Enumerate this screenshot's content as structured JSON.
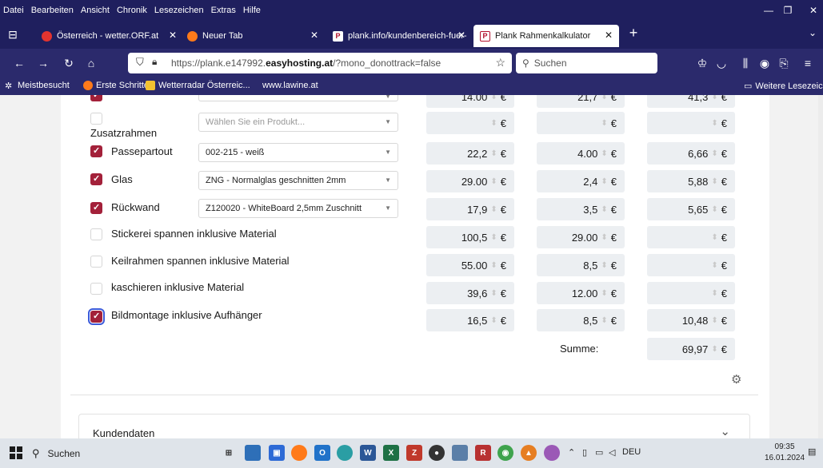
{
  "menubar": {
    "items": [
      "Datei",
      "Bearbeiten",
      "Ansicht",
      "Chronik",
      "Lesezeichen",
      "Extras",
      "Hilfe"
    ]
  },
  "tabs": [
    {
      "label": "Österreich - wetter.ORF.at"
    },
    {
      "label": "Neuer Tab"
    },
    {
      "label": "plank.info/kundenbereich-fuer-"
    },
    {
      "label": "Plank Rahmenkalkulator"
    }
  ],
  "navbar": {
    "url_prefix": "https://plank.e147992.",
    "url_domain": "easyhosting.at",
    "url_suffix": "/?mono_donottrack=false",
    "search_placeholder": "Suchen"
  },
  "bookmarks": {
    "items": [
      "Meistbesucht",
      "Erste Schritte",
      "Wetterradar Österreic...",
      "www.lawine.at"
    ],
    "more": "Weitere Lesezeichen"
  },
  "calculator": {
    "partial_prices": [
      "14.00",
      "21,7",
      "41,3"
    ],
    "rows": [
      {
        "label": "Zusatzrahmen",
        "checked": false,
        "select": "Wählen Sie ein Produkt...",
        "p1": "",
        "p2": "",
        "p3": ""
      },
      {
        "label": "Passepartout",
        "checked": true,
        "select": "002-215 - weiß",
        "p1": "22,2",
        "p2": "4.00",
        "p3": "6,66"
      },
      {
        "label": "Glas",
        "checked": true,
        "select": "ZNG - Normalglas geschnitten 2mm",
        "p1": "29.00",
        "p2": "2,4",
        "p3": "5,88"
      },
      {
        "label": "Rückwand",
        "checked": true,
        "select": "Z120020 - WhiteBoard 2,5mm Zuschnitt",
        "p1": "17,9",
        "p2": "3,5",
        "p3": "5,65"
      },
      {
        "label": "Stickerei spannen inklusive Material",
        "checked": false,
        "p1": "100,5",
        "p2": "29.00",
        "p3": ""
      },
      {
        "label": "Keilrahmen spannen inklusive Material",
        "checked": false,
        "p1": "55.00",
        "p2": "8,5",
        "p3": ""
      },
      {
        "label": "kaschieren inklusive Material",
        "checked": false,
        "p1": "39,6",
        "p2": "12.00",
        "p3": ""
      },
      {
        "label": "Bildmontage inklusive Aufhänger",
        "checked": true,
        "p1": "16,5",
        "p2": "8,5",
        "p3": "10,48"
      }
    ],
    "currency": "€",
    "summe_label": "Summe:",
    "summe_value": "69,97"
  },
  "customer_card": {
    "title": "Kundendaten"
  },
  "taskbar": {
    "search_label": "Suchen",
    "language": "DEU",
    "time": "09:35",
    "date": "16.01.2024"
  },
  "colors": {
    "chrome": "#1f1f5e",
    "checkbox_checked": "#a3213a",
    "price_field": "#eceff2"
  }
}
